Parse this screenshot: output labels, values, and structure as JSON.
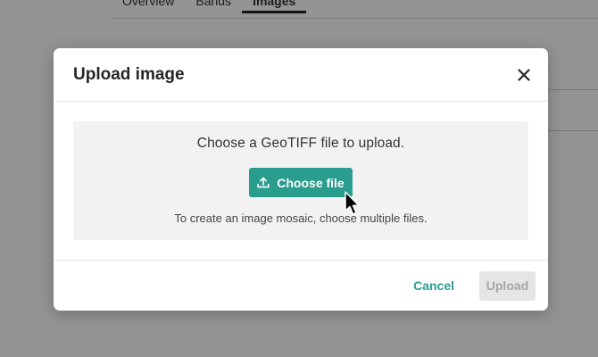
{
  "background": {
    "tabs": [
      {
        "label": "Overview"
      },
      {
        "label": "Bands"
      },
      {
        "label": "Images",
        "active": true
      }
    ]
  },
  "modal": {
    "title": "Upload image",
    "prompt": "Choose a GeoTIFF file to upload.",
    "choose_button_label": "Choose file",
    "hint": "To create an image mosaic, choose multiple files.",
    "cancel_label": "Cancel",
    "upload_label": "Upload",
    "upload_enabled": false
  },
  "icons": {
    "close": "close-icon",
    "upload": "upload-icon",
    "cursor": "mouse-pointer-icon"
  },
  "colors": {
    "accent": "#2a9d8f",
    "disabled_bg": "#e5e5e5",
    "disabled_text": "#a6a6a6",
    "drop_zone_bg": "#f2f2f2"
  }
}
